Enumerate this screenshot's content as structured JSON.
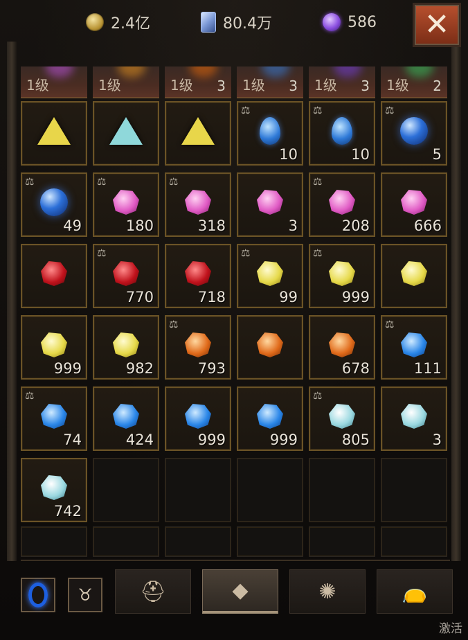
{
  "currency": {
    "gold": "2.4亿",
    "crystal": "80.4万",
    "purple": "586"
  },
  "close_symbol": "✕",
  "tabs": [
    {
      "level": "1级",
      "count": "",
      "glow": "#a04ab0"
    },
    {
      "level": "1级",
      "count": "",
      "glow": "#c07a20"
    },
    {
      "level": "1级",
      "count": "3",
      "glow": "#c05a10"
    },
    {
      "level": "1级",
      "count": "3",
      "glow": "#3a6ab0"
    },
    {
      "level": "1级",
      "count": "3",
      "glow": "#6a3ab0"
    },
    {
      "level": "1级",
      "count": "2",
      "glow": "#3aa050"
    }
  ],
  "gem_rows": [
    [
      {
        "kind": "tri",
        "color": "yellow",
        "count": "",
        "locked": false
      },
      {
        "kind": "tri",
        "color": "cyan",
        "count": "",
        "locked": false
      },
      {
        "kind": "tri",
        "color": "yellow",
        "count": "",
        "locked": false
      },
      {
        "kind": "drop",
        "color": "blue",
        "count": "10",
        "locked": true
      },
      {
        "kind": "drop",
        "color": "blue",
        "count": "10",
        "locked": true
      },
      {
        "kind": "orb",
        "color": "blue",
        "count": "5",
        "locked": true
      }
    ],
    [
      {
        "kind": "orb",
        "color": "blue",
        "count": "49",
        "locked": true
      },
      {
        "kind": "rock",
        "color": "pink",
        "count": "180",
        "locked": true
      },
      {
        "kind": "rock",
        "color": "pink",
        "count": "318",
        "locked": true
      },
      {
        "kind": "rock",
        "color": "pink",
        "count": "3",
        "locked": false
      },
      {
        "kind": "rock",
        "color": "pink",
        "count": "208",
        "locked": true
      },
      {
        "kind": "rock",
        "color": "pink",
        "count": "666",
        "locked": false
      }
    ],
    [
      {
        "kind": "rock",
        "color": "red",
        "count": "",
        "locked": false
      },
      {
        "kind": "rock",
        "color": "red",
        "count": "770",
        "locked": true
      },
      {
        "kind": "rock",
        "color": "red",
        "count": "718",
        "locked": false
      },
      {
        "kind": "rock",
        "color": "yellow",
        "count": "99",
        "locked": true
      },
      {
        "kind": "rock",
        "color": "yellow",
        "count": "999",
        "locked": true
      },
      {
        "kind": "rock",
        "color": "yellow",
        "count": "",
        "locked": false
      }
    ],
    [
      {
        "kind": "rock",
        "color": "yellow",
        "count": "999",
        "locked": false
      },
      {
        "kind": "rock",
        "color": "yellow",
        "count": "982",
        "locked": false
      },
      {
        "kind": "rock",
        "color": "orange",
        "count": "793",
        "locked": true
      },
      {
        "kind": "rock",
        "color": "orange",
        "count": "",
        "locked": false
      },
      {
        "kind": "rock",
        "color": "orange",
        "count": "678",
        "locked": false
      },
      {
        "kind": "rock",
        "color": "blue",
        "count": "111",
        "locked": true
      }
    ],
    [
      {
        "kind": "rock",
        "color": "blue",
        "count": "74",
        "locked": true
      },
      {
        "kind": "rock",
        "color": "blue",
        "count": "424",
        "locked": false
      },
      {
        "kind": "rock",
        "color": "blue",
        "count": "999",
        "locked": false
      },
      {
        "kind": "rock",
        "color": "blue",
        "count": "999",
        "locked": false
      },
      {
        "kind": "rock",
        "color": "cyan",
        "count": "805",
        "locked": true
      },
      {
        "kind": "rock",
        "color": "cyan",
        "count": "3",
        "locked": false
      }
    ],
    [
      {
        "kind": "rock",
        "color": "cyan",
        "count": "742",
        "locked": false
      }
    ]
  ],
  "lock_icon": "⚖",
  "bottom": {
    "categories": [
      "helmet-icon",
      "gem-icon",
      "rune-icon",
      "bag-icon"
    ],
    "active_category": 1,
    "activate_label": "激活"
  }
}
